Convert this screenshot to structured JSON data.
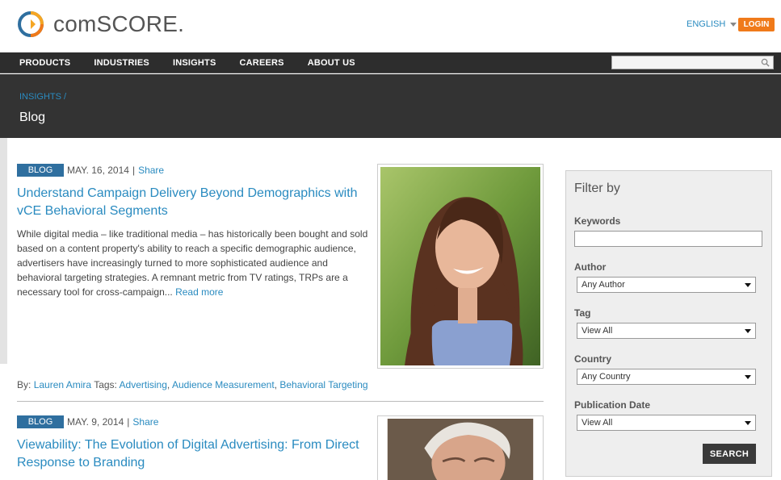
{
  "header": {
    "brand": "comSCORE.",
    "language": "ENGLISH",
    "login_label": "LOGIN",
    "colors": {
      "login": "#f07a1a",
      "link": "#2a8bc0"
    }
  },
  "nav": {
    "items": [
      {
        "label": "PRODUCTS"
      },
      {
        "label": "INDUSTRIES"
      },
      {
        "label": "INSIGHTS"
      },
      {
        "label": "CAREERS"
      },
      {
        "label": "ABOUT US"
      }
    ],
    "search_placeholder": ""
  },
  "banner": {
    "breadcrumb": "INSIGHTS /",
    "title": "Blog"
  },
  "articles": [
    {
      "badge": "BLOG",
      "date": "MAY. 16, 2014",
      "separator": "|",
      "share": "Share",
      "title": "Understand Campaign Delivery Beyond Demographics with vCE Behavioral Segments",
      "body": "While digital media – like traditional media – has historically been bought and sold based on a content property's ability to reach a specific demographic audience, advertisers have increasingly turned to more sophisticated audience and behavioral targeting strategies. A remnant metric from TV ratings, TRPs are a necessary tool for cross-campaign...",
      "read_more": "Read more",
      "by_label": "By:",
      "author": "Lauren Amira",
      "tags_label": "Tags:",
      "tags": [
        "Advertising",
        "Audience Measurement",
        "Behavioral Targeting"
      ]
    },
    {
      "badge": "BLOG",
      "date": "MAY. 9, 2014",
      "separator": "|",
      "share": "Share",
      "title": "Viewability: The Evolution of Digital Advertising: From Direct Response to Branding"
    }
  ],
  "filter": {
    "title": "Filter by",
    "keywords_label": "Keywords",
    "keywords_value": "",
    "author_label": "Author",
    "author_value": "Any Author",
    "tag_label": "Tag",
    "tag_value": "View All",
    "country_label": "Country",
    "country_value": "Any Country",
    "date_label": "Publication Date",
    "date_value": "View All",
    "search_label": "SEARCH"
  }
}
